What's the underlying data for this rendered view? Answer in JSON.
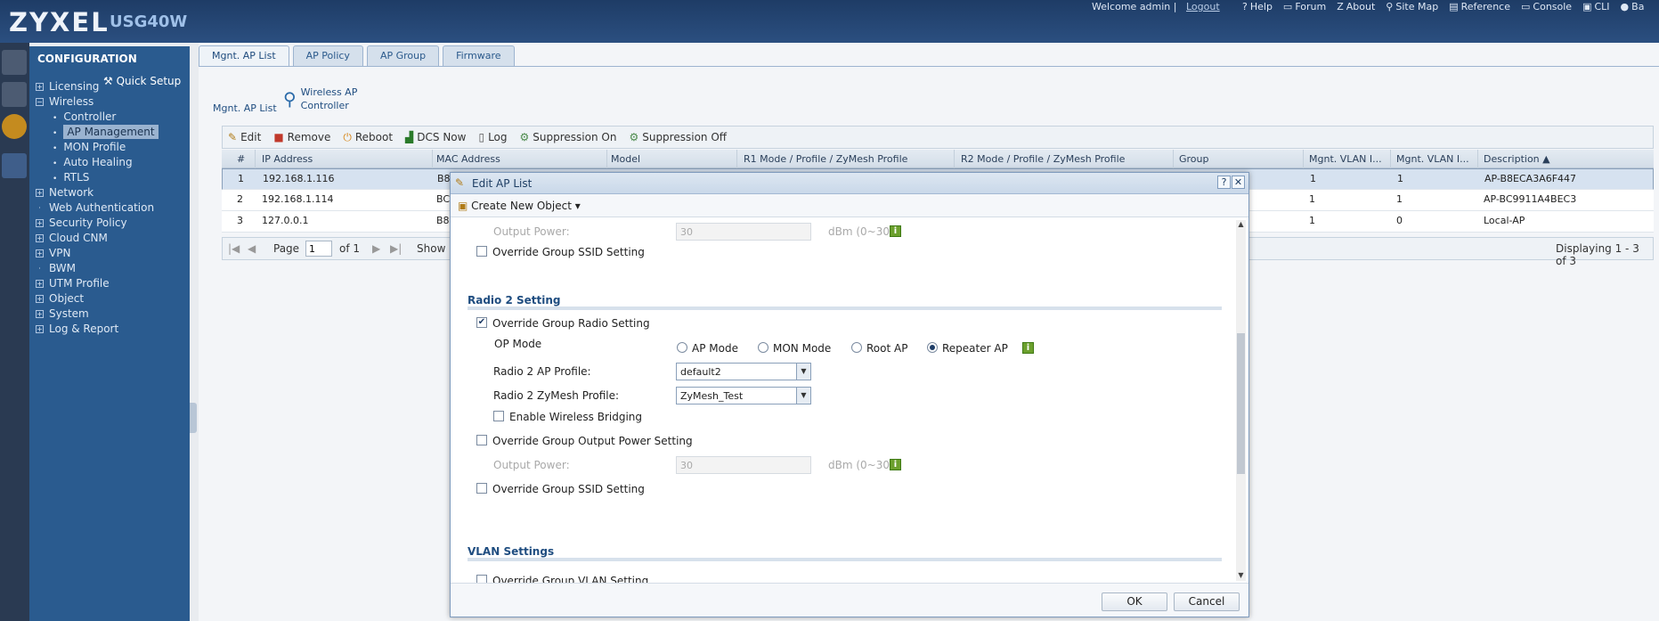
{
  "header": {
    "logo": "ZYXEL",
    "model": "USG40W",
    "welcome": "Welcome admin |",
    "logout": "Logout",
    "links": [
      {
        "icon": "help-icon",
        "glyph": "?",
        "label": "Help"
      },
      {
        "icon": "forum-icon",
        "glyph": "▭",
        "label": "Forum"
      },
      {
        "icon": "about-icon",
        "glyph": "Z",
        "label": "About"
      },
      {
        "icon": "sitemap-icon",
        "glyph": "⚲",
        "label": "Site Map"
      },
      {
        "icon": "reference-icon",
        "glyph": "▤",
        "label": "Reference"
      },
      {
        "icon": "console-icon",
        "glyph": "▭",
        "label": "Console"
      },
      {
        "icon": "cli-icon",
        "glyph": "▣",
        "label": "CLI"
      },
      {
        "icon": "logout-icon",
        "glyph": "●",
        "label": "Ba"
      }
    ]
  },
  "sidebar": {
    "title": "CONFIGURATION",
    "quick_setup": "Quick Setup",
    "items": [
      {
        "label": "Licensing",
        "sign": "+"
      },
      {
        "label": "Wireless",
        "sign": "−"
      },
      {
        "label": "Network",
        "sign": "+"
      },
      {
        "label": "Web Authentication",
        "sign": "·"
      },
      {
        "label": "Security Policy",
        "sign": "+"
      },
      {
        "label": "Cloud CNM",
        "sign": "+"
      },
      {
        "label": "VPN",
        "sign": "+"
      },
      {
        "label": "BWM",
        "sign": "·"
      },
      {
        "label": "UTM Profile",
        "sign": "+"
      },
      {
        "label": "Object",
        "sign": "+"
      },
      {
        "label": "System",
        "sign": "+"
      },
      {
        "label": "Log & Report",
        "sign": "+"
      }
    ],
    "wireless_sub": [
      "Controller",
      "AP Management",
      "MON Profile",
      "Auto Healing",
      "RTLS"
    ]
  },
  "tabs": [
    "Mgnt. AP List",
    "AP Policy",
    "AP Group",
    "Firmware"
  ],
  "section": {
    "title": "Mgnt. AP List",
    "wac_line1": "Wireless AP",
    "wac_line2": "Controller"
  },
  "toolbar": {
    "edit": "Edit",
    "remove": "Remove",
    "reboot": "Reboot",
    "dcs_now": "DCS Now",
    "log": "Log",
    "suppression_on": "Suppression On",
    "suppression_off": "Suppression Off"
  },
  "grid": {
    "columns": [
      "#",
      "IP Address",
      "MAC Address",
      "Model",
      "R1 Mode / Profile / ZyMesh Profile",
      "R2 Mode / Profile / ZyMesh Profile",
      "Group",
      "Mgnt. VLAN I...",
      "Mgnt. VLAN I...",
      "Description ▲"
    ],
    "rows": [
      {
        "num": "1",
        "ip": "192.168.1.116",
        "mac": "B8",
        "vlan1": "1",
        "vlan2": "1",
        "desc": "AP-B8ECA3A6F447"
      },
      {
        "num": "2",
        "ip": "192.168.1.114",
        "mac": "BC",
        "vlan1": "1",
        "vlan2": "1",
        "desc": "AP-BC9911A4BEC3"
      },
      {
        "num": "3",
        "ip": "127.0.0.1",
        "mac": "B8",
        "vlan1": "1",
        "vlan2": "0",
        "desc": "Local-AP"
      }
    ]
  },
  "pager": {
    "page_label": "Page",
    "page_value": "1",
    "of_label": "of 1",
    "show_label": "Show",
    "displaying": "Displaying 1 - 3 of 3"
  },
  "modal": {
    "title": "Edit AP List",
    "help": "?",
    "close": "✕",
    "create_new": "Create New Object ▾",
    "output_power_label": "Output Power:",
    "output_power_value": "30",
    "dbm_range": "dBm (0~30)",
    "override_ssid_1": "Override Group SSID Setting",
    "radio2_title": "Radio 2 Setting",
    "override_radio": "Override Group Radio Setting",
    "op_mode_label": "OP Mode",
    "op_modes": [
      "AP Mode",
      "MON Mode",
      "Root AP",
      "Repeater AP"
    ],
    "selected_op_mode": "Repeater AP",
    "ap_profile_label": "Radio 2 AP Profile:",
    "ap_profile_value": "default2",
    "zymesh_label": "Radio 2 ZyMesh Profile:",
    "zymesh_value": "ZyMesh_Test",
    "enable_bridging": "Enable Wireless Bridging",
    "override_output": "Override Group Output Power Setting",
    "output_power_label_2": "Output Power:",
    "output_power_value_2": "30",
    "dbm_range_2": "dBm (0~30)",
    "override_ssid_2": "Override Group SSID Setting",
    "vlan_title": "VLAN Settings",
    "override_vlan": "Override Group VLAN Setting",
    "ok": "OK",
    "cancel": "Cancel"
  },
  "colors": {
    "header_bg": "#1e3c66",
    "sidebar_bg": "#2a5b8f",
    "accent": "#1f4d80",
    "info_green": "#6ca02d"
  }
}
